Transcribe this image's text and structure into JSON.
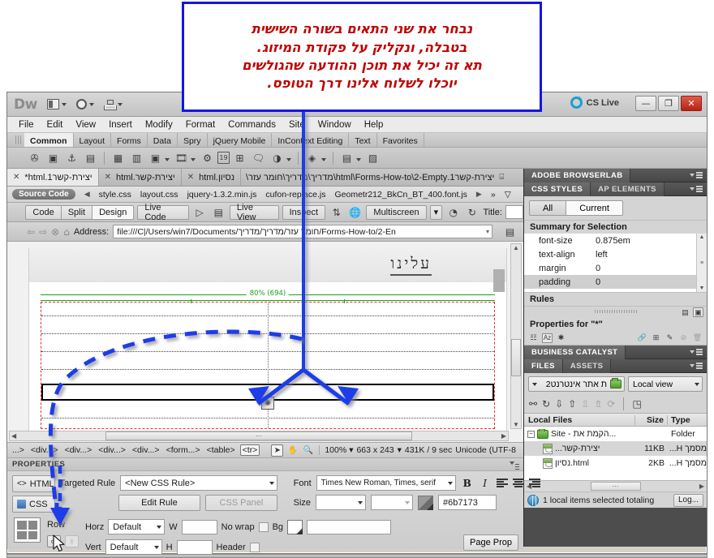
{
  "callout": {
    "text": "נבחר את שני התאים בשורה השישית\nבטבלה, ונקליק על פקודת המיזוג.\nתא זה יכיל את תוכן ההודעה שהגולשים\nיוכלו לשלוח אלינו דרך הטופס.",
    "border_color": "#1414e6",
    "text_color": "#c00000"
  },
  "titlebar": {
    "logo": "Dw",
    "cs_live": "CS Live",
    "minimize": "—",
    "restore": "❐",
    "close": "✕",
    "icons": [
      "workspace-switcher-icon",
      "gear-icon",
      "site-tree-icon"
    ]
  },
  "menubar": {
    "items": [
      "File",
      "Edit",
      "View",
      "Insert",
      "Modify",
      "Format",
      "Commands",
      "Site",
      "Window",
      "Help"
    ]
  },
  "insert_panel": {
    "tabs": [
      "Common",
      "Layout",
      "Forms",
      "Data",
      "Spry",
      "jQuery Mobile",
      "InContext Editing",
      "Text",
      "Favorites"
    ],
    "active_tab": "Common",
    "icons": [
      {
        "name": "hyperlink-icon",
        "glyph": "✇"
      },
      {
        "name": "email-link-icon",
        "glyph": "▣"
      },
      {
        "name": "named-anchor-icon",
        "glyph": "⚓"
      },
      {
        "name": "horizontal-rule-icon",
        "glyph": "▤"
      },
      {
        "name": "table-icon",
        "glyph": "▦"
      },
      {
        "name": "insert-div-icon",
        "glyph": "▥"
      },
      {
        "name": "image-icon",
        "glyph": "▣"
      },
      {
        "name": "media-icon",
        "glyph": "🎞"
      },
      {
        "name": "widget-icon",
        "glyph": "⚙"
      },
      {
        "name": "date-icon",
        "glyph": "19"
      },
      {
        "name": "server-side-include-icon",
        "glyph": "⊞"
      },
      {
        "name": "comment-icon",
        "glyph": "💬"
      },
      {
        "name": "head-tag-icon",
        "glyph": "◐"
      },
      {
        "name": "template-icon",
        "glyph": "◈"
      },
      {
        "name": "tag-chooser-icon",
        "glyph": "▤"
      },
      {
        "name": "recently-used-icon",
        "glyph": "▨"
      }
    ]
  },
  "doc_tabs": {
    "tabs": [
      {
        "label": "יצירת-קשר1.html*",
        "active": true,
        "close": "✕"
      },
      {
        "label": "יצירת-קשר.html",
        "active": false,
        "close": "✕"
      },
      {
        "label": "נסיון.html",
        "active": false,
        "close": "✕"
      }
    ],
    "path": "יצירת-קשר1.html\\Forms-How-to\\2-Empty\\מדריך\\מדריך\\חומר עזר\\",
    "pin_icon": "pin-icon"
  },
  "related_files": {
    "source_code": "Source Code",
    "files": [
      "style.css",
      "layout.css",
      "jquery-1.3.2.min.js",
      "cufon-replace.js",
      "Geometr212_BkCn_BT_400.font.js"
    ],
    "more_icon": "»",
    "filter_icon": "filter-icon"
  },
  "doc_toolbar": {
    "view_buttons": [
      "Code",
      "Split",
      "Design"
    ],
    "active_view": "Design",
    "live_code": "Live Code",
    "live_view": "Live View",
    "inspect": "Inspect",
    "multiscreen": "Multiscreen",
    "title_label": "Title:",
    "title_value": "",
    "icons": [
      "live-view-options-icon",
      "visual-aids-icon",
      "validate-icon",
      "browser-preview-icon",
      "refresh-icon"
    ]
  },
  "address_bar": {
    "label": "Address:",
    "value": "file:///C|/Users/win7/Documents/חומר עזר/מדריך/מדריך/Forms-How-to/2-En",
    "nav_icons": [
      "back-icon",
      "forward-icon",
      "stop-icon",
      "home-icon"
    ],
    "file-management-icon": "▤"
  },
  "canvas": {
    "site_title": "עלינו",
    "width_indicator": "80% (694)",
    "merge_handle_icon": "merge-cells-handle-icon",
    "scroll_grip": "⋯"
  },
  "statusbar": {
    "tags": [
      "...>",
      "<div...>",
      "<div...>",
      "<div...>",
      "<div...>",
      "<form...>",
      "<table>",
      "<tr>"
    ],
    "selected_tag": "<tr>",
    "tools": [
      {
        "name": "select-tool-icon",
        "glyph": "➤",
        "selected": true
      },
      {
        "name": "hand-tool-icon",
        "glyph": "✋",
        "selected": false
      },
      {
        "name": "zoom-tool-icon",
        "glyph": "🔍",
        "selected": false
      }
    ],
    "zoom": "100%",
    "window_size": "663 x 243",
    "download": "431K / 9 sec",
    "encoding": "Unicode (UTF-8"
  },
  "properties": {
    "title": "PROPERTIES",
    "html_btn": "HTML",
    "css_btn": "CSS",
    "targeted_rule_label": "Targeted Rule",
    "targeted_rule_value": "<New CSS Rule>",
    "edit_rule": "Edit Rule",
    "css_panel": "CSS Panel",
    "font_label": "Font",
    "font_value": "Times New Roman, Times, serif",
    "size_label": "Size",
    "size_value": "",
    "color_hex": "#6b7173",
    "bold": "B",
    "italic": "I",
    "row_label": "Row",
    "horz_label": "Horz",
    "horz_value": "Default",
    "vert_label": "Vert",
    "vert_value": "Default",
    "w_label": "W",
    "w_value": "",
    "h_label": "H",
    "h_value": "",
    "nowrap_label": "No wrap",
    "header_label": "Header",
    "bg_label": "Bg",
    "bg_value": "",
    "page_properties": "Page Prop",
    "merge_cells_icon": "merge-cells-icon",
    "split_cell_icon": "split-cell-icon"
  },
  "right_panels": {
    "browserlab": {
      "title": "ADOBE BROWSERLAB"
    },
    "css_styles": {
      "tabs": [
        "CSS STYLES",
        "AP ELEMENTS"
      ],
      "active_tab": "CSS STYLES",
      "all_btn": "All",
      "current_btn": "Current",
      "active_btn": "Current",
      "summary_title": "Summary for Selection",
      "summary_rows": [
        {
          "property": "font-size",
          "value": "0.875em"
        },
        {
          "property": "text-align",
          "value": "left"
        },
        {
          "property": "margin",
          "value": "0"
        },
        {
          "property": "padding",
          "value": "0"
        }
      ],
      "rules_title": "Rules",
      "properties_title": "Properties for \"*\"",
      "prop_icons": [
        "category-view-icon",
        "az-sort-icon",
        "set-properties-icon",
        "attach-style-sheet-icon",
        "new-css-rule-icon",
        "edit-rule-icon",
        "disable-property-icon",
        "delete-property-icon"
      ]
    },
    "business_catalyst": {
      "title": "BUSINESS CATALYST"
    },
    "files": {
      "tabs": [
        "FILES",
        "ASSETS"
      ],
      "active_tab": "FILES",
      "site_name": "ת אתר אינטרנט2",
      "view": "Local view",
      "toolbar_icons": [
        "connect-icon",
        "refresh-icon",
        "get-files-icon",
        "put-files-icon",
        "check-out-icon",
        "check-in-icon",
        "synchronize-icon",
        "expand-icon"
      ],
      "columns": [
        "Local Files",
        "Size",
        "Type"
      ],
      "rows": [
        {
          "name": "Site - הקמת את...",
          "size": "",
          "type": "Folder",
          "is_folder": true,
          "selected": false,
          "indent": 0
        },
        {
          "name": "...יצירת-קשר",
          "size": "11KB",
          "type": "מסמך H...",
          "is_folder": false,
          "selected": true,
          "indent": 1
        },
        {
          "name": "נסיון.html",
          "size": "2KB",
          "type": "מסמך H...",
          "is_folder": false,
          "selected": false,
          "indent": 1
        }
      ],
      "status": "1 local items selected totaling",
      "log_btn": "Log..."
    }
  }
}
